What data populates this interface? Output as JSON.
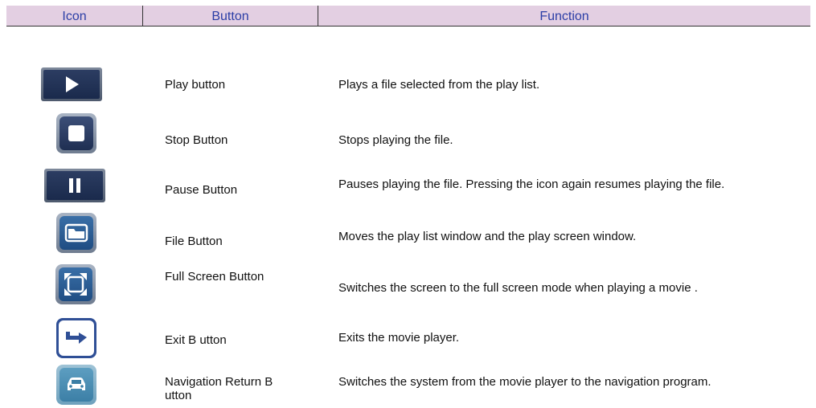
{
  "header": {
    "icon": "Icon",
    "button": "Button",
    "function": "Function"
  },
  "rows": [
    {
      "icon": "play-icon",
      "label": "Play button",
      "description": "Plays a file selected from the play list."
    },
    {
      "icon": "stop-icon",
      "label": "Stop Button",
      "description": "Stops playing the file."
    },
    {
      "icon": "pause-icon",
      "label": "Pause Button",
      "description": "Pauses playing the file. Pressing the icon again resumes playing the file."
    },
    {
      "icon": "folder-icon",
      "label": "File Button",
      "description": "Moves the play list window and the play screen window."
    },
    {
      "icon": "fullscreen-icon",
      "label": "Full Screen Button",
      "description": "Switches the screen to the full screen mode when playing a movie ."
    },
    {
      "icon": "exit-arrow-icon",
      "label": "Exit B utton",
      "description": "Exits the movie player."
    },
    {
      "icon": "car-icon",
      "label": "Navigation Return B utton",
      "description": "Switches the system from the movie player to the navigation program."
    }
  ]
}
